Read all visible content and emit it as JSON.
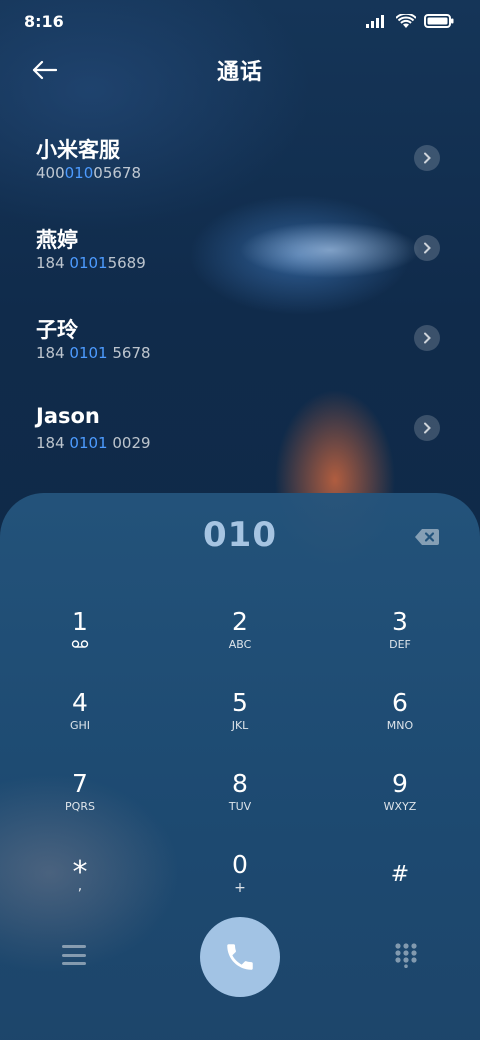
{
  "status": {
    "time": "8:16"
  },
  "header": {
    "title": "通话"
  },
  "contacts": [
    {
      "name": "小米客服",
      "num_pre": "400",
      "num_hl": "010",
      "num_post": "05678"
    },
    {
      "name": "燕婷",
      "num_pre": "184 ",
      "num_hl": "0101",
      "num_post": "5689"
    },
    {
      "name": "子玲",
      "num_pre": "184 ",
      "num_hl": "0101",
      "num_post": " 5678"
    },
    {
      "name": "Jason",
      "num_pre": "184 ",
      "num_hl": "0101",
      "num_post": " 0029"
    }
  ],
  "dialer": {
    "input": "010",
    "keys": [
      {
        "digit": "1",
        "letters": ""
      },
      {
        "digit": "2",
        "letters": "ABC"
      },
      {
        "digit": "3",
        "letters": "DEF"
      },
      {
        "digit": "4",
        "letters": "GHI"
      },
      {
        "digit": "5",
        "letters": "JKL"
      },
      {
        "digit": "6",
        "letters": "MNO"
      },
      {
        "digit": "7",
        "letters": "PQRS"
      },
      {
        "digit": "8",
        "letters": "TUV"
      },
      {
        "digit": "9",
        "letters": "WXYZ"
      },
      {
        "digit": "*",
        "letters": ","
      },
      {
        "digit": "0",
        "letters": "+"
      },
      {
        "digit": "#",
        "letters": ""
      }
    ]
  },
  "colors": {
    "highlight": "#4d9bff",
    "call_button": "#a2c3e4",
    "display_text": "#a6c4e2"
  },
  "icons": [
    "back-arrow-icon",
    "signal-icon",
    "wifi-icon",
    "battery-icon",
    "chevron-right-icon",
    "backspace-icon",
    "voicemail-icon",
    "menu-icon",
    "phone-icon",
    "dialpad-icon"
  ]
}
